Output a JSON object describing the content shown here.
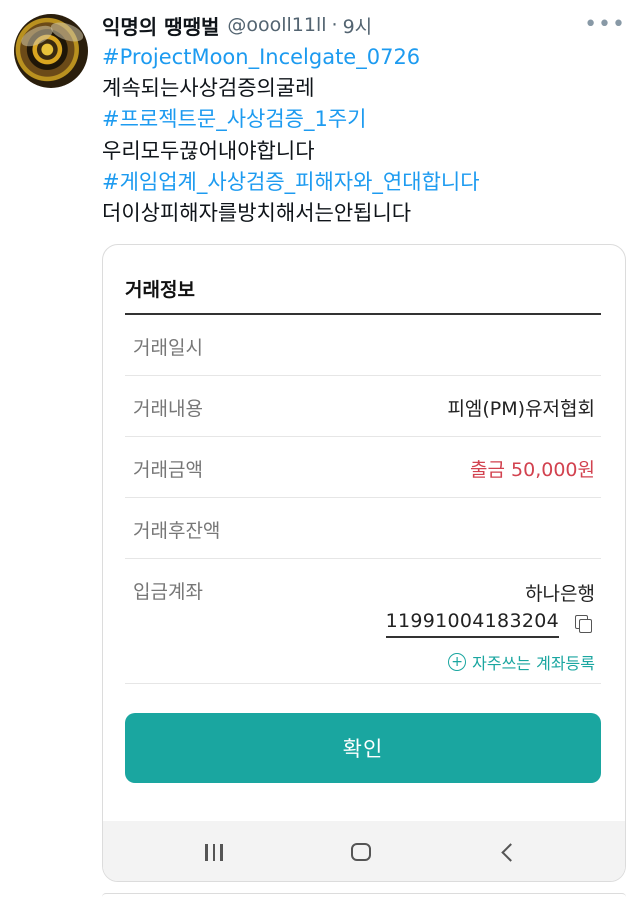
{
  "tweet": {
    "display_name": "익명의 땡땡벌",
    "handle": "@oooll11ll",
    "separator": "·",
    "time": "9시",
    "more_icon": "more-horizontal-icon",
    "lines": [
      {
        "text": "#ProjectMoon_Incelgate_0726",
        "hashtag": true
      },
      {
        "text": "계속되는사상검증의굴레",
        "hashtag": false
      },
      {
        "text": "#프로젝트문_사상검증_1주기",
        "hashtag": true
      },
      {
        "text": "우리모두끊어내야합니다",
        "hashtag": false
      },
      {
        "text": "#게임업계_사상검증_피해자와_연대합니다",
        "hashtag": true
      },
      {
        "text": "더이상피해자를방치해서는안됩니다",
        "hashtag": false
      }
    ]
  },
  "receipt": {
    "title": "거래정보",
    "rows": {
      "datetime": {
        "label": "거래일시",
        "value": ""
      },
      "description": {
        "label": "거래내용",
        "value": "피엠(PM)유저협회"
      },
      "amount": {
        "label": "거래금액",
        "value": "출금 50,000원"
      },
      "balance": {
        "label": "거래후잔액",
        "value": ""
      },
      "account": {
        "label": "입금계좌",
        "bank": "하나은행",
        "number": "11991004183204"
      }
    },
    "register_link": "자주쓰는 계좌등록",
    "confirm_label": "확인"
  },
  "navbar": {
    "items": [
      "recents-icon",
      "home-icon",
      "back-icon"
    ]
  },
  "colors": {
    "hashtag": "#1d9bf0",
    "accent": "#1aa6a0",
    "amount": "#d2424f"
  }
}
